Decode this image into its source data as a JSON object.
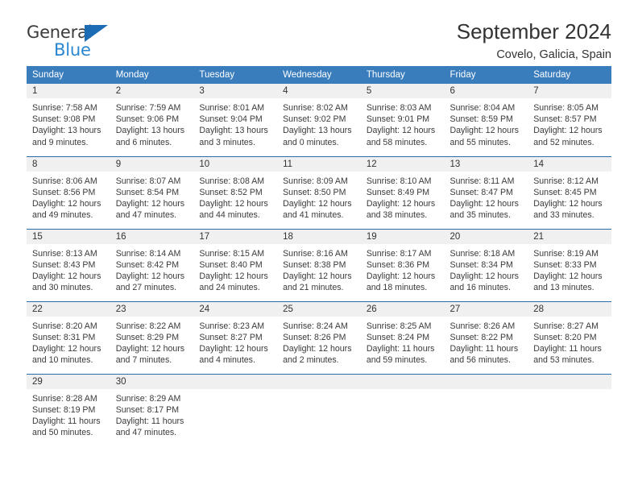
{
  "brand": {
    "name_top": "General",
    "name_bottom": "Blue",
    "triangle_color": "#1b6cb3",
    "blue_text_color": "#2a86d0"
  },
  "header": {
    "title": "September 2024",
    "subtitle": "Covelo, Galicia, Spain"
  },
  "theme": {
    "header_blue": "#3a7dbd",
    "row_divider_blue": "#2b6ca8",
    "daynum_band": "#f0f0f0"
  },
  "weekday_headers": [
    "Sunday",
    "Monday",
    "Tuesday",
    "Wednesday",
    "Thursday",
    "Friday",
    "Saturday"
  ],
  "weeks": [
    [
      {
        "day": "1",
        "sunrise": "Sunrise: 7:58 AM",
        "sunset": "Sunset: 9:08 PM",
        "daylight": "Daylight: 13 hours and 9 minutes."
      },
      {
        "day": "2",
        "sunrise": "Sunrise: 7:59 AM",
        "sunset": "Sunset: 9:06 PM",
        "daylight": "Daylight: 13 hours and 6 minutes."
      },
      {
        "day": "3",
        "sunrise": "Sunrise: 8:01 AM",
        "sunset": "Sunset: 9:04 PM",
        "daylight": "Daylight: 13 hours and 3 minutes."
      },
      {
        "day": "4",
        "sunrise": "Sunrise: 8:02 AM",
        "sunset": "Sunset: 9:02 PM",
        "daylight": "Daylight: 13 hours and 0 minutes."
      },
      {
        "day": "5",
        "sunrise": "Sunrise: 8:03 AM",
        "sunset": "Sunset: 9:01 PM",
        "daylight": "Daylight: 12 hours and 58 minutes."
      },
      {
        "day": "6",
        "sunrise": "Sunrise: 8:04 AM",
        "sunset": "Sunset: 8:59 PM",
        "daylight": "Daylight: 12 hours and 55 minutes."
      },
      {
        "day": "7",
        "sunrise": "Sunrise: 8:05 AM",
        "sunset": "Sunset: 8:57 PM",
        "daylight": "Daylight: 12 hours and 52 minutes."
      }
    ],
    [
      {
        "day": "8",
        "sunrise": "Sunrise: 8:06 AM",
        "sunset": "Sunset: 8:56 PM",
        "daylight": "Daylight: 12 hours and 49 minutes."
      },
      {
        "day": "9",
        "sunrise": "Sunrise: 8:07 AM",
        "sunset": "Sunset: 8:54 PM",
        "daylight": "Daylight: 12 hours and 47 minutes."
      },
      {
        "day": "10",
        "sunrise": "Sunrise: 8:08 AM",
        "sunset": "Sunset: 8:52 PM",
        "daylight": "Daylight: 12 hours and 44 minutes."
      },
      {
        "day": "11",
        "sunrise": "Sunrise: 8:09 AM",
        "sunset": "Sunset: 8:50 PM",
        "daylight": "Daylight: 12 hours and 41 minutes."
      },
      {
        "day": "12",
        "sunrise": "Sunrise: 8:10 AM",
        "sunset": "Sunset: 8:49 PM",
        "daylight": "Daylight: 12 hours and 38 minutes."
      },
      {
        "day": "13",
        "sunrise": "Sunrise: 8:11 AM",
        "sunset": "Sunset: 8:47 PM",
        "daylight": "Daylight: 12 hours and 35 minutes."
      },
      {
        "day": "14",
        "sunrise": "Sunrise: 8:12 AM",
        "sunset": "Sunset: 8:45 PM",
        "daylight": "Daylight: 12 hours and 33 minutes."
      }
    ],
    [
      {
        "day": "15",
        "sunrise": "Sunrise: 8:13 AM",
        "sunset": "Sunset: 8:43 PM",
        "daylight": "Daylight: 12 hours and 30 minutes."
      },
      {
        "day": "16",
        "sunrise": "Sunrise: 8:14 AM",
        "sunset": "Sunset: 8:42 PM",
        "daylight": "Daylight: 12 hours and 27 minutes."
      },
      {
        "day": "17",
        "sunrise": "Sunrise: 8:15 AM",
        "sunset": "Sunset: 8:40 PM",
        "daylight": "Daylight: 12 hours and 24 minutes."
      },
      {
        "day": "18",
        "sunrise": "Sunrise: 8:16 AM",
        "sunset": "Sunset: 8:38 PM",
        "daylight": "Daylight: 12 hours and 21 minutes."
      },
      {
        "day": "19",
        "sunrise": "Sunrise: 8:17 AM",
        "sunset": "Sunset: 8:36 PM",
        "daylight": "Daylight: 12 hours and 18 minutes."
      },
      {
        "day": "20",
        "sunrise": "Sunrise: 8:18 AM",
        "sunset": "Sunset: 8:34 PM",
        "daylight": "Daylight: 12 hours and 16 minutes."
      },
      {
        "day": "21",
        "sunrise": "Sunrise: 8:19 AM",
        "sunset": "Sunset: 8:33 PM",
        "daylight": "Daylight: 12 hours and 13 minutes."
      }
    ],
    [
      {
        "day": "22",
        "sunrise": "Sunrise: 8:20 AM",
        "sunset": "Sunset: 8:31 PM",
        "daylight": "Daylight: 12 hours and 10 minutes."
      },
      {
        "day": "23",
        "sunrise": "Sunrise: 8:22 AM",
        "sunset": "Sunset: 8:29 PM",
        "daylight": "Daylight: 12 hours and 7 minutes."
      },
      {
        "day": "24",
        "sunrise": "Sunrise: 8:23 AM",
        "sunset": "Sunset: 8:27 PM",
        "daylight": "Daylight: 12 hours and 4 minutes."
      },
      {
        "day": "25",
        "sunrise": "Sunrise: 8:24 AM",
        "sunset": "Sunset: 8:26 PM",
        "daylight": "Daylight: 12 hours and 2 minutes."
      },
      {
        "day": "26",
        "sunrise": "Sunrise: 8:25 AM",
        "sunset": "Sunset: 8:24 PM",
        "daylight": "Daylight: 11 hours and 59 minutes."
      },
      {
        "day": "27",
        "sunrise": "Sunrise: 8:26 AM",
        "sunset": "Sunset: 8:22 PM",
        "daylight": "Daylight: 11 hours and 56 minutes."
      },
      {
        "day": "28",
        "sunrise": "Sunrise: 8:27 AM",
        "sunset": "Sunset: 8:20 PM",
        "daylight": "Daylight: 11 hours and 53 minutes."
      }
    ],
    [
      {
        "day": "29",
        "sunrise": "Sunrise: 8:28 AM",
        "sunset": "Sunset: 8:19 PM",
        "daylight": "Daylight: 11 hours and 50 minutes."
      },
      {
        "day": "30",
        "sunrise": "Sunrise: 8:29 AM",
        "sunset": "Sunset: 8:17 PM",
        "daylight": "Daylight: 11 hours and 47 minutes."
      },
      {
        "day": "",
        "sunrise": "",
        "sunset": "",
        "daylight": ""
      },
      {
        "day": "",
        "sunrise": "",
        "sunset": "",
        "daylight": ""
      },
      {
        "day": "",
        "sunrise": "",
        "sunset": "",
        "daylight": ""
      },
      {
        "day": "",
        "sunrise": "",
        "sunset": "",
        "daylight": ""
      },
      {
        "day": "",
        "sunrise": "",
        "sunset": "",
        "daylight": ""
      }
    ]
  ]
}
